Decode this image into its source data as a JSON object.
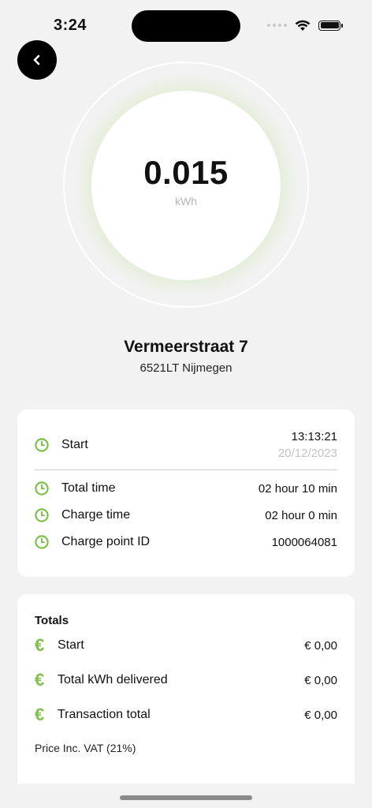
{
  "status_bar": {
    "time": "3:24"
  },
  "gauge": {
    "value": "0.015",
    "unit": "kWh"
  },
  "location": {
    "street": "Vermeerstraat 7",
    "city": "6521LT Nijmegen"
  },
  "session": {
    "start": {
      "label": "Start",
      "time": "13:13:21",
      "date": "20/12/2023"
    },
    "rows": [
      {
        "label": "Total time",
        "value": "02 hour 10 min"
      },
      {
        "label": "Charge time",
        "value": "02 hour 0 min"
      },
      {
        "label": "Charge point ID",
        "value": "1000064081"
      }
    ]
  },
  "totals": {
    "title": "Totals",
    "rows": [
      {
        "label": "Start",
        "value": "€ 0,00"
      },
      {
        "label": "Total kWh delivered",
        "value": "€ 0,00"
      },
      {
        "label": "Transaction total",
        "value": "€ 0,00"
      }
    ],
    "currency_symbol": "€",
    "note": "Price Inc. VAT (21%)"
  },
  "colors": {
    "accent": "#7fbf4d",
    "glow": "#8cc65a"
  }
}
